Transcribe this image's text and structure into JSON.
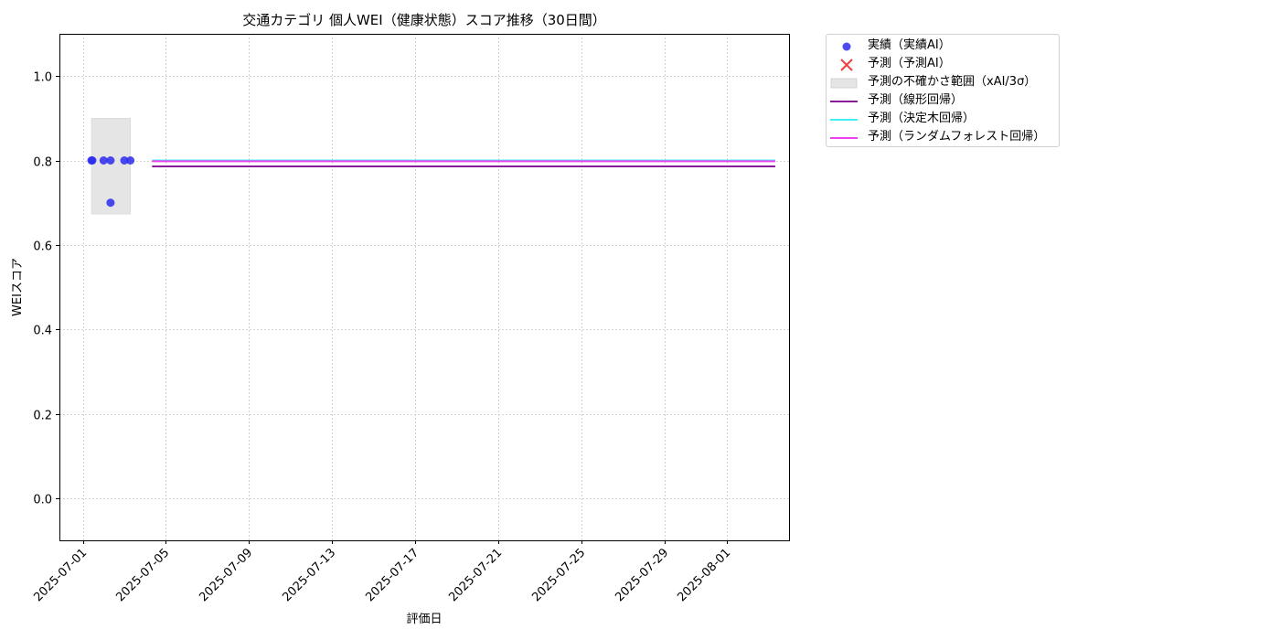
{
  "chart_data": {
    "type": "scatter",
    "title": "交通カテゴリ 個人WEI（健康状態）スコア推移（30日間）",
    "xlabel": "評価日",
    "ylabel": "WEIスコア",
    "ylim": [
      -0.1,
      1.1
    ],
    "xlim": [
      "2025-06-29T21:00",
      "2025-08-04T00:00"
    ],
    "yticks": [
      0.0,
      0.2,
      0.4,
      0.6,
      0.8,
      1.0
    ],
    "ytick_labels": [
      "0.0",
      "0.2",
      "0.4",
      "0.6",
      "0.8",
      "1.0"
    ],
    "xticks": [
      "2025-07-01",
      "2025-07-05",
      "2025-07-09",
      "2025-07-13",
      "2025-07-17",
      "2025-07-21",
      "2025-07-25",
      "2025-07-29",
      "2025-08-01"
    ],
    "grid": true,
    "legend_position": "outside-right",
    "series": [
      {
        "name": "実績（実績AI）",
        "type": "scatter",
        "color": "#2b2bef",
        "points": [
          {
            "x": "2025-07-01T10:00",
            "y": 0.8
          },
          {
            "x": "2025-07-01T11:00",
            "y": 0.8
          },
          {
            "x": "2025-07-02T00:00",
            "y": 0.8
          },
          {
            "x": "2025-07-02T08:00",
            "y": 0.8
          },
          {
            "x": "2025-07-02T08:00",
            "y": 0.7
          },
          {
            "x": "2025-07-03T00:00",
            "y": 0.8
          },
          {
            "x": "2025-07-03T07:00",
            "y": 0.8
          }
        ]
      },
      {
        "name": "予測（予測AI）",
        "type": "scatter",
        "color": "#f04040",
        "points": []
      },
      {
        "name": "予測の不確かさ範囲（xAI/3σ）",
        "type": "band",
        "color": "#e5e5e5",
        "x_start": "2025-07-01T10:00",
        "x_end": "2025-07-03T07:00",
        "y_low": 0.673,
        "y_high": 0.9
      },
      {
        "name": "予測（線形回帰）",
        "type": "line",
        "color": "#8b1a9b",
        "points": [
          {
            "x": "2025-07-04T08:00",
            "y": 0.786
          },
          {
            "x": "2025-08-03T08:00",
            "y": 0.786
          }
        ]
      },
      {
        "name": "予測（決定木回帰）",
        "type": "line",
        "color": "#40f0f0",
        "points": [
          {
            "x": "2025-07-04T08:00",
            "y": 0.8
          },
          {
            "x": "2025-08-03T08:00",
            "y": 0.8
          }
        ]
      },
      {
        "name": "予測（ランダムフォレスト回帰）",
        "type": "line",
        "color": "#ee40ee",
        "points": [
          {
            "x": "2025-07-04T08:00",
            "y": 0.798
          },
          {
            "x": "2025-08-03T08:00",
            "y": 0.798
          }
        ]
      }
    ]
  }
}
